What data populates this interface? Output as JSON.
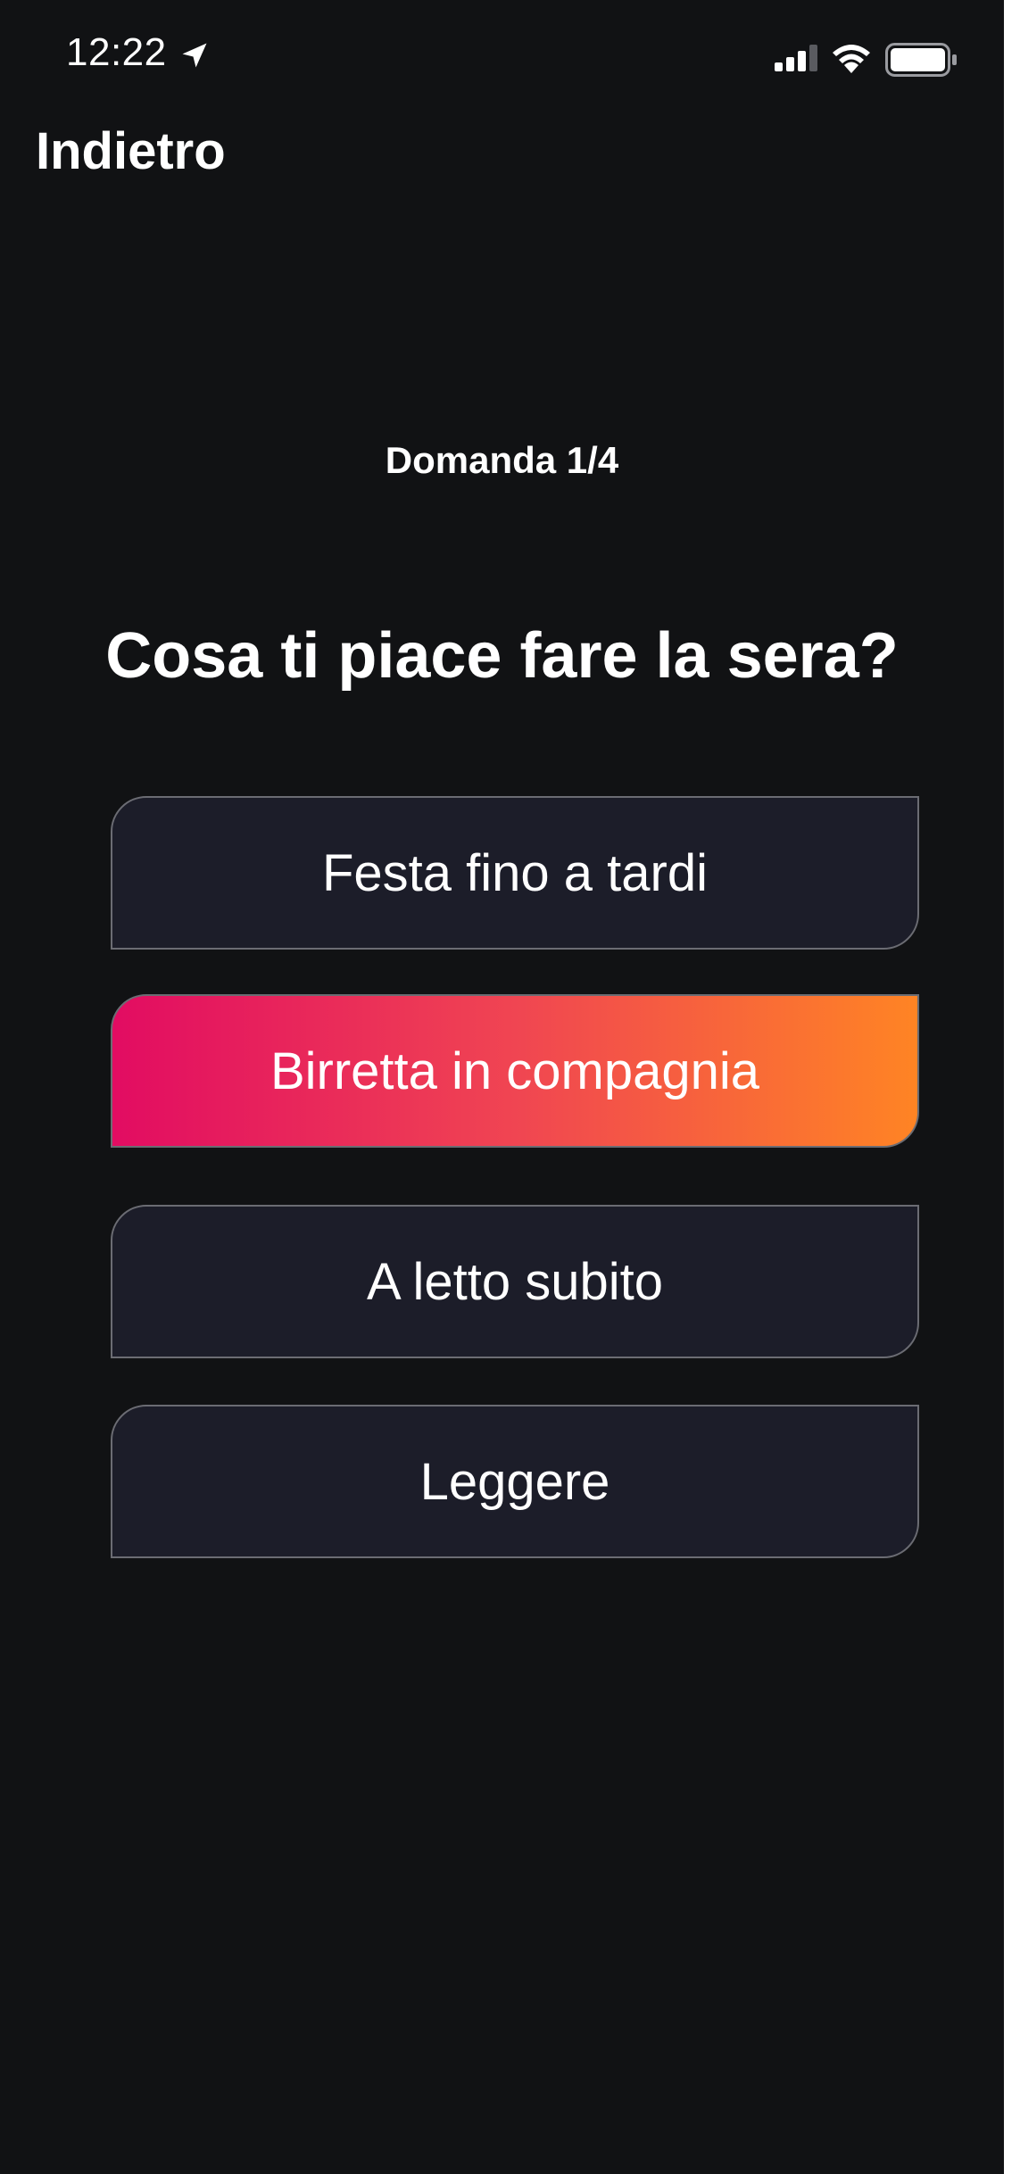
{
  "status_bar": {
    "time": "12:22",
    "icons": [
      "location-arrow-icon",
      "cellular-signal-icon",
      "wifi-icon",
      "battery-icon"
    ]
  },
  "nav": {
    "back_label": "Indietro"
  },
  "quiz": {
    "counter": "Domanda 1/4",
    "question": "Cosa ti piace fare la sera?",
    "answers": [
      {
        "label": "Festa fino a tardi",
        "selected": false
      },
      {
        "label": "Birretta in compagnia",
        "selected": true
      },
      {
        "label": "A letto subito",
        "selected": false
      },
      {
        "label": "Leggere",
        "selected": false
      }
    ]
  },
  "colors": {
    "background": "#111214",
    "answer_background": "#1c1d29",
    "answer_border": "#6b6c73",
    "selected_gradient_start": "#e20c62",
    "selected_gradient_end": "#ff8424",
    "text": "#ffffff"
  }
}
